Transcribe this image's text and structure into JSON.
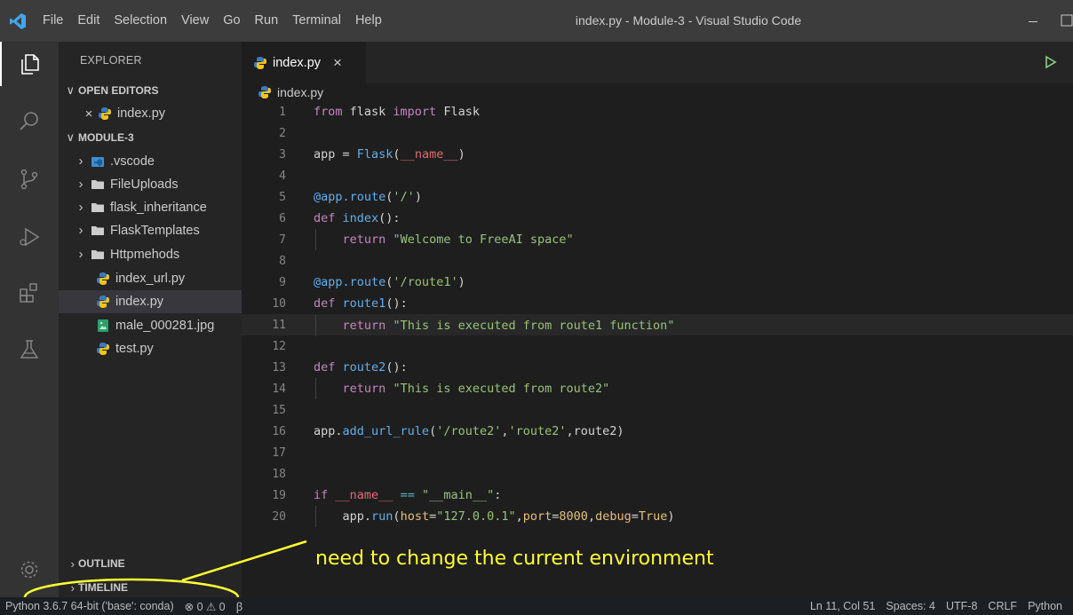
{
  "window": {
    "title": "index.py - Module-3 - Visual Studio Code",
    "menus": [
      "File",
      "Edit",
      "Selection",
      "View",
      "Go",
      "Run",
      "Terminal",
      "Help"
    ]
  },
  "activity_bar": {
    "icons": [
      "explorer-icon",
      "search-icon",
      "source-control-icon",
      "run-debug-icon",
      "extensions-icon",
      "testing-icon",
      "settings-gear-icon"
    ]
  },
  "sidebar": {
    "title": "EXPLORER",
    "open_editors": {
      "header": "OPEN EDITORS",
      "items": [
        {
          "label": "index.py",
          "icon": "python-icon"
        }
      ]
    },
    "folder": {
      "header": "MODULE-3",
      "items": [
        {
          "label": ".vscode",
          "type": "folder",
          "icon": "vscode-folder-icon"
        },
        {
          "label": "FileUploads",
          "type": "folder",
          "icon": "folder-icon"
        },
        {
          "label": "flask_inheritance",
          "type": "folder",
          "icon": "folder-icon"
        },
        {
          "label": "FlaskTemplates",
          "type": "folder",
          "icon": "folder-icon"
        },
        {
          "label": "Httpmehods",
          "type": "folder",
          "icon": "folder-icon"
        },
        {
          "label": "index_url.py",
          "type": "file",
          "icon": "python-icon"
        },
        {
          "label": "index.py",
          "type": "file",
          "icon": "python-icon",
          "selected": true
        },
        {
          "label": "male_000281.jpg",
          "type": "file",
          "icon": "image-icon"
        },
        {
          "label": "test.py",
          "type": "file",
          "icon": "python-icon"
        }
      ]
    },
    "outline": {
      "header": "OUTLINE"
    },
    "timeline": {
      "header": "TIMELINE"
    }
  },
  "tabs": [
    {
      "label": "index.py",
      "active": true
    }
  ],
  "breadcrumb": "index.py",
  "editor": {
    "current_line": 11,
    "lines": [
      {
        "n": "1",
        "code": "from flask import Flask"
      },
      {
        "n": "2",
        "code": ""
      },
      {
        "n": "3",
        "code": "app = Flask(__name__)"
      },
      {
        "n": "4",
        "code": ""
      },
      {
        "n": "5",
        "code": "@app.route('/')"
      },
      {
        "n": "6",
        "code": "def index():"
      },
      {
        "n": "7",
        "code": "    return \"Welcome to FreeAI space\""
      },
      {
        "n": "8",
        "code": ""
      },
      {
        "n": "9",
        "code": "@app.route('/route1')"
      },
      {
        "n": "10",
        "code": "def route1():"
      },
      {
        "n": "11",
        "code": "    return \"This is executed from route1 function\""
      },
      {
        "n": "12",
        "code": ""
      },
      {
        "n": "13",
        "code": "def route2():"
      },
      {
        "n": "14",
        "code": "    return \"This is executed from route2\""
      },
      {
        "n": "15",
        "code": ""
      },
      {
        "n": "16",
        "code": "app.add_url_rule('/route2','route2',route2)"
      },
      {
        "n": "17",
        "code": ""
      },
      {
        "n": "18",
        "code": ""
      },
      {
        "n": "19",
        "code": "if __name__ == \"__main__\":"
      },
      {
        "n": "20",
        "code": "    app.run(host=\"127.0.0.1\",port=8000,debug=True)"
      }
    ]
  },
  "annotation": {
    "text": "need to change the current environment",
    "color": "#ffff33"
  },
  "statusbar": {
    "interpreter": "Python 3.6.7 64-bit ('base': conda)",
    "problems": "⊗ 0 ⚠ 0",
    "sync": "ꞵ",
    "cursor": "Ln 11, Col 51",
    "spaces": "Spaces: 4",
    "encoding": "UTF-8",
    "eol": "CRLF",
    "language": "Python"
  }
}
